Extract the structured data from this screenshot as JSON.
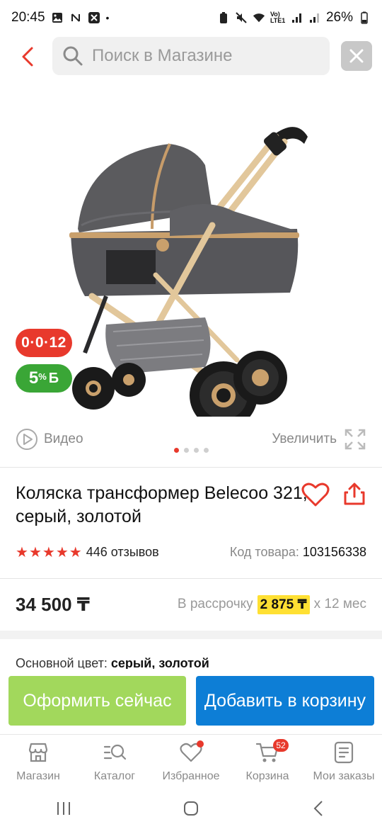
{
  "status": {
    "time": "20:45",
    "battery": "26%",
    "network": "Vo) LTE1"
  },
  "search": {
    "placeholder": "Поиск в Магазине"
  },
  "badges": {
    "installment": "0·0·12",
    "bonus_percent": "5",
    "bonus_sup": "%",
    "bonus_letter": "Б"
  },
  "gallery": {
    "video_label": "Видео",
    "zoom_label": "Увеличить",
    "slide_count": 4,
    "active_slide": 1
  },
  "product": {
    "title": "Коляска трансформер Belecoo 321, серый, золотой",
    "rating_stars": 5,
    "reviews": "446 отзывов",
    "code_label": "Код товара:",
    "code_value": "103156338",
    "price": "34 500 ₸",
    "installment_prefix": "В рассрочку",
    "installment_amount": "2 875 ₸",
    "installment_suffix": "x 12 мес",
    "color_label": "Основной цвет:",
    "color_value": "серый, золотой"
  },
  "actions": {
    "buy_now": "Оформить сейчас",
    "add_to_cart": "Добавить в корзину"
  },
  "tabs": [
    {
      "label": "Магазин",
      "icon": "shop-icon"
    },
    {
      "label": "Каталог",
      "icon": "catalog-search-icon"
    },
    {
      "label": "Избранное",
      "icon": "heart-icon"
    },
    {
      "label": "Корзина",
      "icon": "cart-icon",
      "badge": "52"
    },
    {
      "label": "Мои заказы",
      "icon": "orders-icon"
    }
  ],
  "colors": {
    "accent_red": "#e8392c",
    "buy_green": "#a2d85c",
    "cart_blue": "#0d7ed6",
    "bonus_green": "#3aa636",
    "installment_yellow": "#ffe033"
  }
}
